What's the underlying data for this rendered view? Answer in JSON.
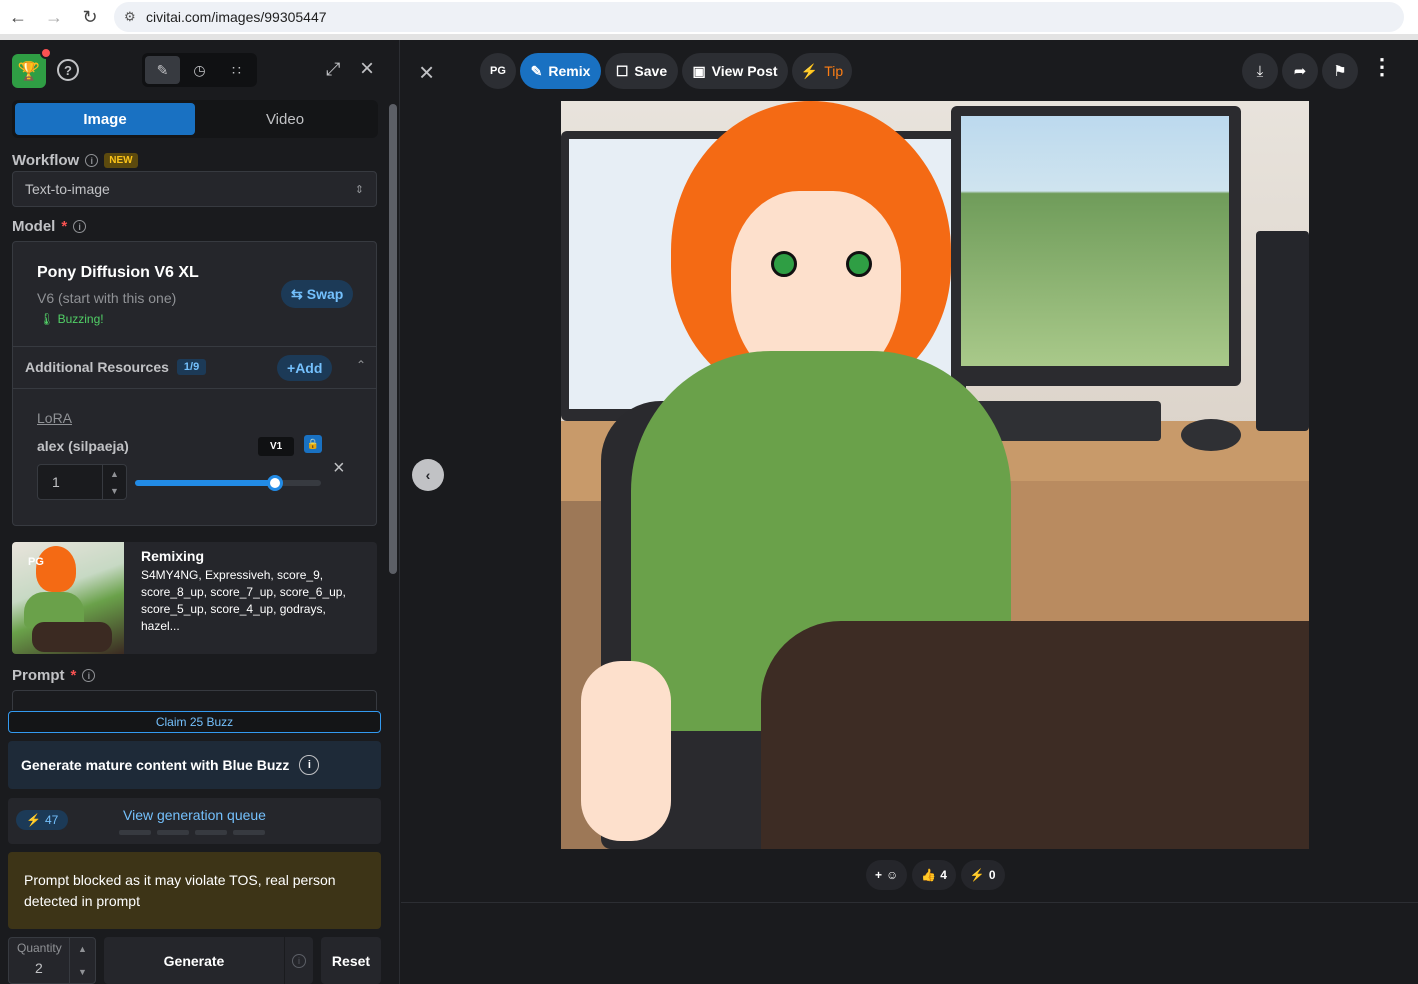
{
  "browser": {
    "url": "civitai.com/images/99305447",
    "back_icon": "arrow-left-icon",
    "forward_icon": "arrow-right-icon",
    "reload_icon": "reload-icon"
  },
  "generator": {
    "tabs": [
      "Image",
      "Video"
    ],
    "workflow_label": "Workflow",
    "workflow_badge": "NEW",
    "workflow_value": "Text-to-image",
    "model_label": "Model",
    "required_mark": "*",
    "model": {
      "name": "Pony Diffusion V6 XL",
      "version": "V6 (start with this one)",
      "status": "Buzzing!",
      "swap_label": "Swap"
    },
    "resources": {
      "label": "Additional Resources",
      "count": "1/9",
      "add_label": "Add",
      "lora_type": "LoRA",
      "lora_name": "alex (silpaeja)",
      "lora_version": "V1",
      "strength": "1",
      "strength_fraction": 0.75
    },
    "remix": {
      "title": "Remixing",
      "rating": "PG",
      "text": "S4MY4NG, Expressiveh, score_9, score_8_up, score_7_up, score_6_up, score_5_up, score_4_up, godrays, hazel..."
    },
    "prompt_label": "Prompt",
    "claim_label": "Claim 25 Buzz",
    "mature_label": "Generate mature content with Blue Buzz",
    "buzz_count": "47",
    "queue_label": "View generation queue",
    "blocked_message": "Prompt blocked as it may violate TOS, real person detected in prompt",
    "quantity_label": "Quantity",
    "quantity_value": "2",
    "generate_label": "Generate",
    "reset_label": "Reset"
  },
  "viewer": {
    "rating": "PG",
    "remix_label": "Remix",
    "save_label": "Save",
    "view_post_label": "View Post",
    "tip_label": "Tip",
    "reactions": {
      "like_count": "4",
      "buzz_count": "0"
    }
  },
  "colors": {
    "accent": "#1971c2",
    "buzz": "#fcc419",
    "warning_bg": "#3d3417"
  }
}
